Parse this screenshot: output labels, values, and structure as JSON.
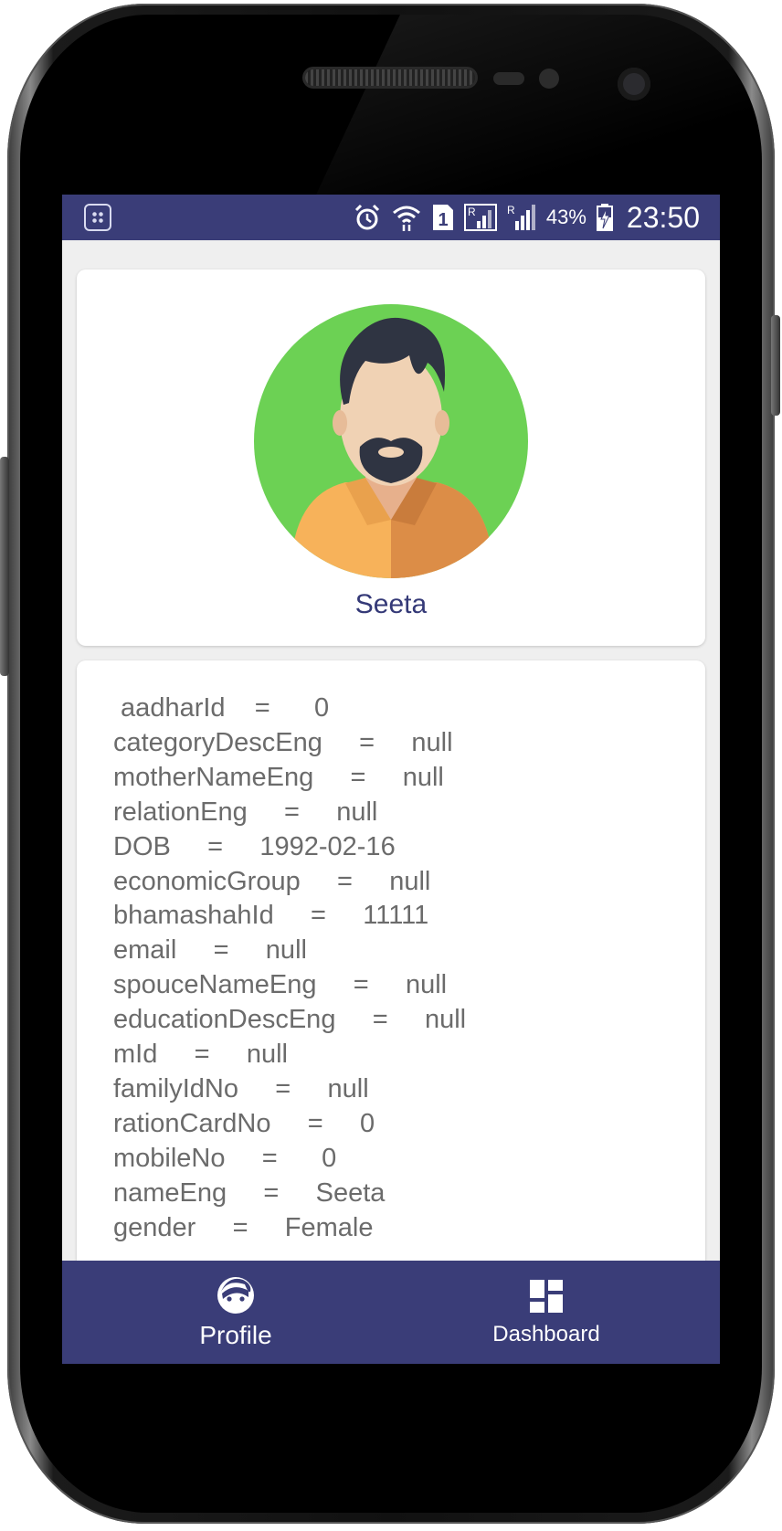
{
  "status_bar": {
    "battery_percent": "43%",
    "time": "23:50",
    "sim_slot": "1",
    "roaming_badges": [
      "R",
      "R"
    ],
    "icons": [
      "app-notification-icon",
      "alarm-icon",
      "wifi-icon",
      "sim-1-icon",
      "signal-roaming-icon",
      "signal-roaming-icon",
      "battery-charging-icon"
    ]
  },
  "profile": {
    "name": "Seeta",
    "avatar_icon": "male-avatar-icon",
    "avatar_bg_color": "#6cd154"
  },
  "details": {
    "rows": [
      " aadharId    =      0",
      "categoryDescEng     =     null",
      "motherNameEng     =     null",
      "relationEng     =     null",
      "DOB     =     1992-02-16",
      "economicGroup     =     null",
      "bhamashahId     =     11111",
      "email     =     null",
      "spouceNameEng     =     null",
      "educationDescEng     =     null",
      "mId     =     null",
      "familyIdNo     =     null",
      "rationCardNo     =     0",
      "mobileNo     =      0",
      "nameEng     =     Seeta",
      "gender     =     Female"
    ]
  },
  "bottom_nav": {
    "profile_label": "Profile",
    "dashboard_label": "Dashboard"
  },
  "colors": {
    "primary": "#3a3d78",
    "name_text": "#343977",
    "detail_text": "#6b6b6b",
    "screen_bg": "#efefef"
  }
}
